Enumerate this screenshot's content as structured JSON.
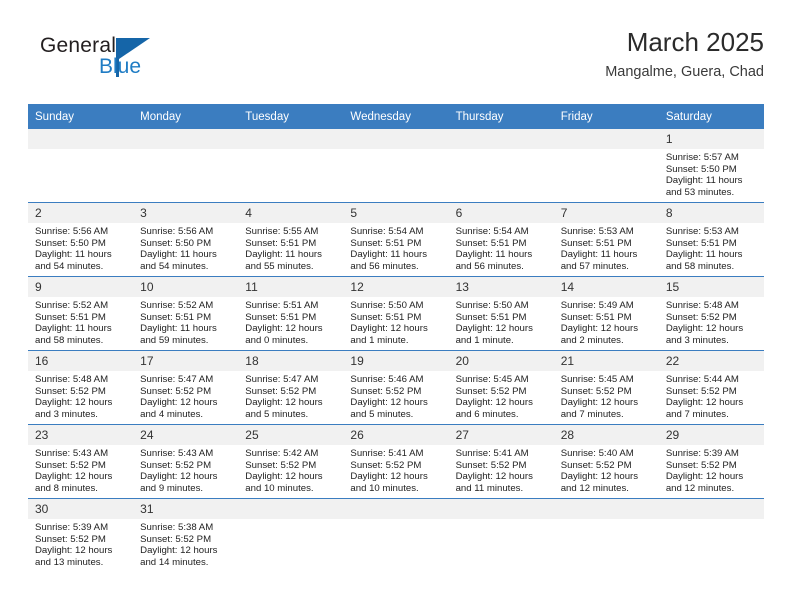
{
  "brand": {
    "name_part1": "General",
    "name_part2": "Blue",
    "triangle_color": "#1565a8",
    "blue_color": "#1f7cc4"
  },
  "header": {
    "title": "March 2025",
    "subtitle": "Mangalme, Guera, Chad"
  },
  "theme": {
    "header_bg": "#3b7dc0",
    "daynum_bg": "#f1f1f1",
    "grid_line": "#3b7dc0"
  },
  "weekday_headers": [
    "Sunday",
    "Monday",
    "Tuesday",
    "Wednesday",
    "Thursday",
    "Friday",
    "Saturday"
  ],
  "weeks": [
    [
      {
        "day": "",
        "blank": true
      },
      {
        "day": "",
        "blank": true
      },
      {
        "day": "",
        "blank": true
      },
      {
        "day": "",
        "blank": true
      },
      {
        "day": "",
        "blank": true
      },
      {
        "day": "",
        "blank": true
      },
      {
        "day": "1",
        "sunrise": "Sunrise: 5:57 AM",
        "sunset": "Sunset: 5:50 PM",
        "daylight": "Daylight: 11 hours and 53 minutes."
      }
    ],
    [
      {
        "day": "2",
        "sunrise": "Sunrise: 5:56 AM",
        "sunset": "Sunset: 5:50 PM",
        "daylight": "Daylight: 11 hours and 54 minutes."
      },
      {
        "day": "3",
        "sunrise": "Sunrise: 5:56 AM",
        "sunset": "Sunset: 5:50 PM",
        "daylight": "Daylight: 11 hours and 54 minutes."
      },
      {
        "day": "4",
        "sunrise": "Sunrise: 5:55 AM",
        "sunset": "Sunset: 5:51 PM",
        "daylight": "Daylight: 11 hours and 55 minutes."
      },
      {
        "day": "5",
        "sunrise": "Sunrise: 5:54 AM",
        "sunset": "Sunset: 5:51 PM",
        "daylight": "Daylight: 11 hours and 56 minutes."
      },
      {
        "day": "6",
        "sunrise": "Sunrise: 5:54 AM",
        "sunset": "Sunset: 5:51 PM",
        "daylight": "Daylight: 11 hours and 56 minutes."
      },
      {
        "day": "7",
        "sunrise": "Sunrise: 5:53 AM",
        "sunset": "Sunset: 5:51 PM",
        "daylight": "Daylight: 11 hours and 57 minutes."
      },
      {
        "day": "8",
        "sunrise": "Sunrise: 5:53 AM",
        "sunset": "Sunset: 5:51 PM",
        "daylight": "Daylight: 11 hours and 58 minutes."
      }
    ],
    [
      {
        "day": "9",
        "sunrise": "Sunrise: 5:52 AM",
        "sunset": "Sunset: 5:51 PM",
        "daylight": "Daylight: 11 hours and 58 minutes."
      },
      {
        "day": "10",
        "sunrise": "Sunrise: 5:52 AM",
        "sunset": "Sunset: 5:51 PM",
        "daylight": "Daylight: 11 hours and 59 minutes."
      },
      {
        "day": "11",
        "sunrise": "Sunrise: 5:51 AM",
        "sunset": "Sunset: 5:51 PM",
        "daylight": "Daylight: 12 hours and 0 minutes."
      },
      {
        "day": "12",
        "sunrise": "Sunrise: 5:50 AM",
        "sunset": "Sunset: 5:51 PM",
        "daylight": "Daylight: 12 hours and 1 minute."
      },
      {
        "day": "13",
        "sunrise": "Sunrise: 5:50 AM",
        "sunset": "Sunset: 5:51 PM",
        "daylight": "Daylight: 12 hours and 1 minute."
      },
      {
        "day": "14",
        "sunrise": "Sunrise: 5:49 AM",
        "sunset": "Sunset: 5:51 PM",
        "daylight": "Daylight: 12 hours and 2 minutes."
      },
      {
        "day": "15",
        "sunrise": "Sunrise: 5:48 AM",
        "sunset": "Sunset: 5:52 PM",
        "daylight": "Daylight: 12 hours and 3 minutes."
      }
    ],
    [
      {
        "day": "16",
        "sunrise": "Sunrise: 5:48 AM",
        "sunset": "Sunset: 5:52 PM",
        "daylight": "Daylight: 12 hours and 3 minutes."
      },
      {
        "day": "17",
        "sunrise": "Sunrise: 5:47 AM",
        "sunset": "Sunset: 5:52 PM",
        "daylight": "Daylight: 12 hours and 4 minutes."
      },
      {
        "day": "18",
        "sunrise": "Sunrise: 5:47 AM",
        "sunset": "Sunset: 5:52 PM",
        "daylight": "Daylight: 12 hours and 5 minutes."
      },
      {
        "day": "19",
        "sunrise": "Sunrise: 5:46 AM",
        "sunset": "Sunset: 5:52 PM",
        "daylight": "Daylight: 12 hours and 5 minutes."
      },
      {
        "day": "20",
        "sunrise": "Sunrise: 5:45 AM",
        "sunset": "Sunset: 5:52 PM",
        "daylight": "Daylight: 12 hours and 6 minutes."
      },
      {
        "day": "21",
        "sunrise": "Sunrise: 5:45 AM",
        "sunset": "Sunset: 5:52 PM",
        "daylight": "Daylight: 12 hours and 7 minutes."
      },
      {
        "day": "22",
        "sunrise": "Sunrise: 5:44 AM",
        "sunset": "Sunset: 5:52 PM",
        "daylight": "Daylight: 12 hours and 7 minutes."
      }
    ],
    [
      {
        "day": "23",
        "sunrise": "Sunrise: 5:43 AM",
        "sunset": "Sunset: 5:52 PM",
        "daylight": "Daylight: 12 hours and 8 minutes."
      },
      {
        "day": "24",
        "sunrise": "Sunrise: 5:43 AM",
        "sunset": "Sunset: 5:52 PM",
        "daylight": "Daylight: 12 hours and 9 minutes."
      },
      {
        "day": "25",
        "sunrise": "Sunrise: 5:42 AM",
        "sunset": "Sunset: 5:52 PM",
        "daylight": "Daylight: 12 hours and 10 minutes."
      },
      {
        "day": "26",
        "sunrise": "Sunrise: 5:41 AM",
        "sunset": "Sunset: 5:52 PM",
        "daylight": "Daylight: 12 hours and 10 minutes."
      },
      {
        "day": "27",
        "sunrise": "Sunrise: 5:41 AM",
        "sunset": "Sunset: 5:52 PM",
        "daylight": "Daylight: 12 hours and 11 minutes."
      },
      {
        "day": "28",
        "sunrise": "Sunrise: 5:40 AM",
        "sunset": "Sunset: 5:52 PM",
        "daylight": "Daylight: 12 hours and 12 minutes."
      },
      {
        "day": "29",
        "sunrise": "Sunrise: 5:39 AM",
        "sunset": "Sunset: 5:52 PM",
        "daylight": "Daylight: 12 hours and 12 minutes."
      }
    ],
    [
      {
        "day": "30",
        "sunrise": "Sunrise: 5:39 AM",
        "sunset": "Sunset: 5:52 PM",
        "daylight": "Daylight: 12 hours and 13 minutes."
      },
      {
        "day": "31",
        "sunrise": "Sunrise: 5:38 AM",
        "sunset": "Sunset: 5:52 PM",
        "daylight": "Daylight: 12 hours and 14 minutes."
      },
      {
        "day": "",
        "blank": true
      },
      {
        "day": "",
        "blank": true
      },
      {
        "day": "",
        "blank": true
      },
      {
        "day": "",
        "blank": true
      },
      {
        "day": "",
        "blank": true
      }
    ]
  ]
}
